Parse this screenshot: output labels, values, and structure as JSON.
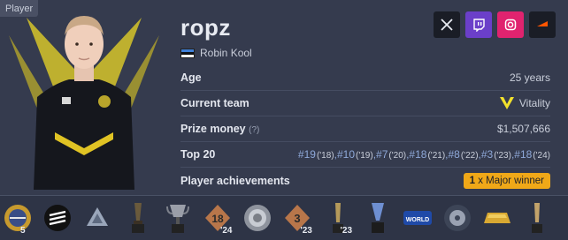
{
  "tag": "Player",
  "player": {
    "nickname": "ropz",
    "real_name": "Robin Kool",
    "country_flag": "estonia-flag"
  },
  "socials": [
    {
      "name": "x-icon"
    },
    {
      "name": "twitch-icon"
    },
    {
      "name": "instagram-icon"
    },
    {
      "name": "faceit-icon"
    }
  ],
  "info": {
    "age_label": "Age",
    "age_value": "25 years",
    "team_label": "Current team",
    "team_value": "Vitality",
    "prize_label": "Prize money",
    "prize_hint": "(?)",
    "prize_value": "$1,507,666",
    "top20_label": "Top 20",
    "top20": [
      {
        "rank": "#19",
        "year": "('18)"
      },
      {
        "rank": ",#10",
        "year": "('19)"
      },
      {
        "rank": ",#7",
        "year": "('20)"
      },
      {
        "rank": ",#18",
        "year": "('21)"
      },
      {
        "rank": ",#8",
        "year": "('22)"
      },
      {
        "rank": ",#3",
        "year": "('23)"
      },
      {
        "rank": ",#18",
        "year": "('24)"
      }
    ],
    "achievements_label": "Player achievements",
    "achievement_count": "1",
    "achievement_text": " x Major winner"
  },
  "trophies": [
    {
      "name": "trophy-gold-medal",
      "count": "5"
    },
    {
      "name": "trophy-esl-logo",
      "count": ""
    },
    {
      "name": "trophy-iem-logo",
      "count": ""
    },
    {
      "name": "trophy-cup-dark",
      "count": ""
    },
    {
      "name": "trophy-cup-silver",
      "count": ""
    },
    {
      "name": "trophy-badge-18",
      "count": "'24",
      "label": "18"
    },
    {
      "name": "trophy-medal-silver",
      "count": ""
    },
    {
      "name": "trophy-badge-3",
      "count": "'23",
      "label": "3"
    },
    {
      "name": "trophy-statuette",
      "count": "'23"
    },
    {
      "name": "trophy-statuette-blue",
      "count": ""
    },
    {
      "name": "trophy-thunderpick-world",
      "count": ""
    },
    {
      "name": "trophy-blast-disc",
      "count": ""
    },
    {
      "name": "trophy-gold-bar",
      "count": ""
    },
    {
      "name": "trophy-award",
      "count": ""
    }
  ],
  "colors": {
    "accent": "#f0a818",
    "link": "#8ea8d8",
    "vitality": "#f2e12c"
  }
}
